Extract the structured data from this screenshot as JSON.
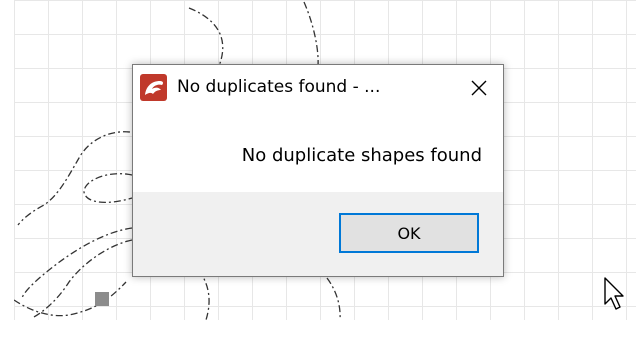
{
  "dialog": {
    "title": "No duplicates found - ...",
    "message": "No duplicate shapes found",
    "ok_label": "OK"
  },
  "icons": {
    "app": "app-logo-icon",
    "close": "close-icon",
    "cursor": "mouse-pointer-icon"
  },
  "colors": {
    "ok_border": "#0078d7",
    "app_icon": "#c0392b",
    "footer": "#f0f0f0"
  }
}
